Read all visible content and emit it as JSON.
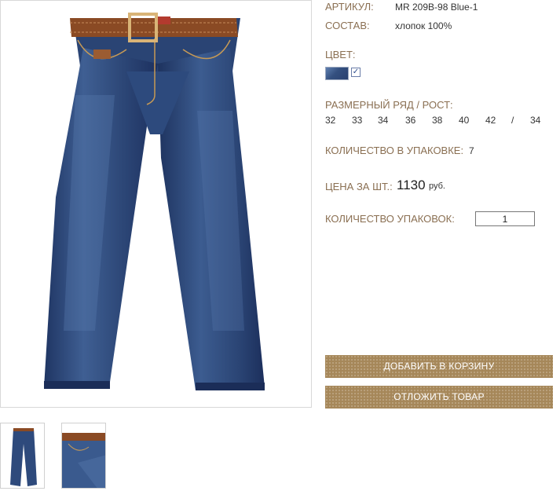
{
  "product": {
    "article_label": "АРТИКУЛ:",
    "article_value": "MR 209B-98 Blue-1",
    "composition_label": "СОСТАВ:",
    "composition_value": "хлопок 100%",
    "color_label": "ЦВЕТ:",
    "color_checked": "✓",
    "size_label": "РАЗМЕРНЫЙ РЯД / РОСТ:",
    "sizes": [
      "32",
      "33",
      "34",
      "36",
      "38",
      "40",
      "42",
      "/",
      "34"
    ],
    "pack_qty_label": "КОЛИЧЕСТВО В УПАКОВКЕ:",
    "pack_qty_value": "7",
    "price_label": "ЦЕНА ЗА ШТ.:",
    "price_value": "1130",
    "price_currency": "руб.",
    "packs_label": "КОЛИЧЕСТВО УПАКОВОК:",
    "packs_value": "1"
  },
  "actions": {
    "add_to_cart": "ДОБАВИТЬ В КОРЗИНУ",
    "postpone": "ОТЛОЖИТЬ ТОВАР"
  },
  "colors": {
    "accent": "#a68759",
    "label": "#8a6f52",
    "denim": "#2e4a7c"
  }
}
